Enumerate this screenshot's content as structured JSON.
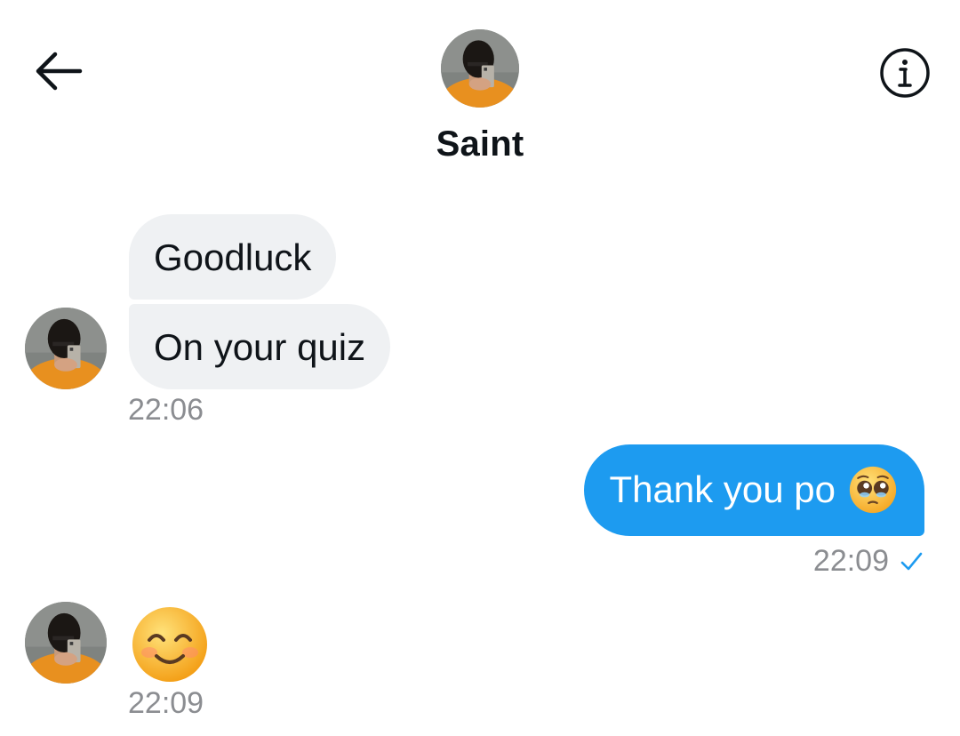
{
  "header": {
    "back_icon": "arrow-left-icon",
    "info_icon": "info-circle-icon",
    "contact_name": "Saint"
  },
  "messages": [
    {
      "direction": "received",
      "text": "Goodluck"
    },
    {
      "direction": "received",
      "text": "On your quiz",
      "time": "22:06"
    },
    {
      "direction": "sent",
      "text": "Thank you po",
      "emoji": "pleading-face-emoji",
      "time": "22:09",
      "status_icon": "check-icon"
    },
    {
      "direction": "received",
      "emoji": "smiling-face-emoji",
      "time": "22:09"
    }
  ],
  "colors": {
    "sent_bubble": "#1d9bf0",
    "received_bubble": "#eff1f3",
    "timestamp": "#8b8d91",
    "check": "#1d9bf0"
  }
}
